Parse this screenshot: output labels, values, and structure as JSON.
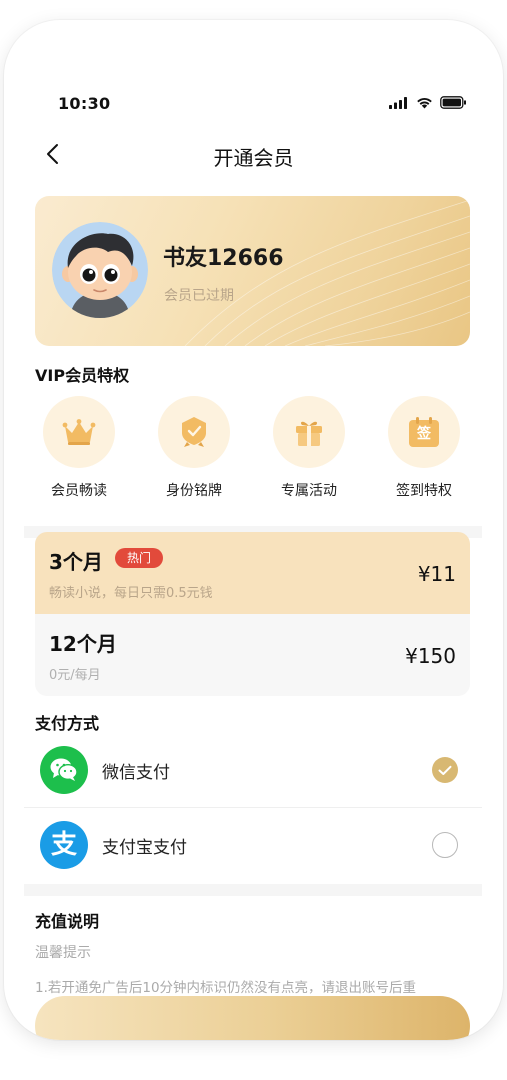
{
  "status_bar": {
    "time": "10:30"
  },
  "nav": {
    "title": "开通会员"
  },
  "profile": {
    "name": "书友12666",
    "status": "会员已过期"
  },
  "vip": {
    "title": "VIP会员特权",
    "items": [
      {
        "label": "会员畅读",
        "icon": "crown-icon"
      },
      {
        "label": "身份铭牌",
        "icon": "badge-icon"
      },
      {
        "label": "专属活动",
        "icon": "gift-icon"
      },
      {
        "label": "签到特权",
        "icon": "checkin-calendar-icon",
        "glyph": "签"
      }
    ]
  },
  "plans": [
    {
      "name": "3个月",
      "badge": "热门",
      "desc": "畅读小说，每日只需0.5元钱",
      "price": "¥11",
      "selected": true
    },
    {
      "name": "12个月",
      "desc": "0元/每月",
      "price": "¥150",
      "selected": false
    }
  ],
  "payment": {
    "title": "支付方式",
    "methods": [
      {
        "label": "微信支付",
        "icon": "wechat-pay-icon",
        "selected": true
      },
      {
        "label": "支付宝支付",
        "icon": "alipay-icon",
        "glyph": "支",
        "selected": false
      }
    ]
  },
  "recharge": {
    "title": "充值说明",
    "tip_label": "温馨提示",
    "tip_text": "1.若开通免广告后10分钟内标识仍然没有点亮，请退出账号后重"
  },
  "colors": {
    "gold": "#d8b872",
    "selected_plan_bg": "#f8e2bd",
    "hot_badge": "#e24a3b",
    "wechat_green": "#1dbf4c",
    "alipay_blue": "#1a9ce6"
  }
}
